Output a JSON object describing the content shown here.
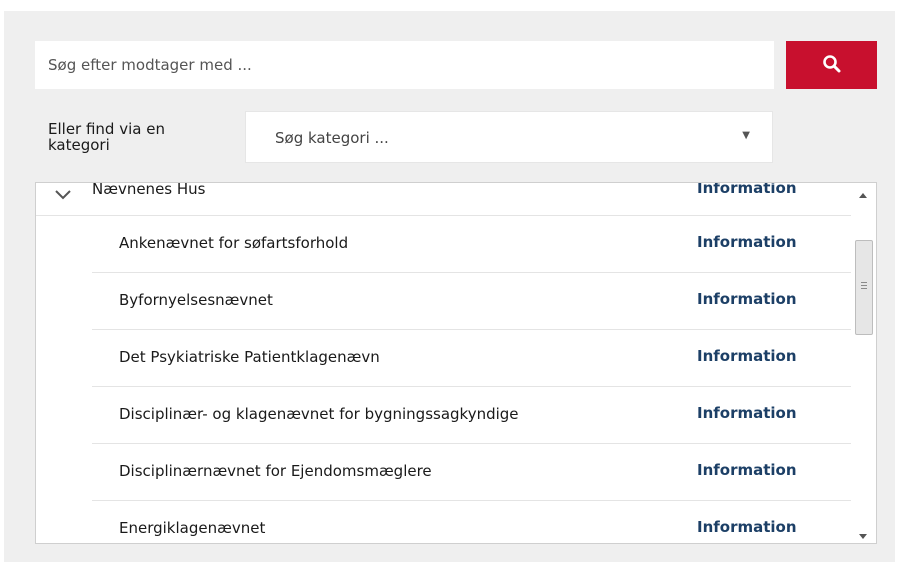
{
  "search": {
    "placeholder": "Søg efter modtager med ...",
    "button_icon": "search-icon",
    "button_color": "#c8102e"
  },
  "category": {
    "label": "Eller find via en kategori",
    "placeholder": "Søg kategori ...",
    "arrow_icon": "caret-down-icon"
  },
  "list": {
    "group": {
      "name": "Nævnenes Hus",
      "info_label": "Information",
      "expand_icon": "chevron-down-icon"
    },
    "items": [
      {
        "name": "Ankenævnet for søfartsforhold",
        "info_label": "Information"
      },
      {
        "name": "Byfornyelsesnævnet",
        "info_label": "Information"
      },
      {
        "name": "Det Psykiatriske Patientklagenævn",
        "info_label": "Information"
      },
      {
        "name": "Disciplinær- og klagenævnet for bygningssagkyndige",
        "info_label": "Information"
      },
      {
        "name": "Disciplinærnævnet for Ejendomsmæglere",
        "info_label": "Information"
      },
      {
        "name": "Energiklagenævnet",
        "info_label": "Information"
      }
    ],
    "link_color": "#1c3f66"
  }
}
